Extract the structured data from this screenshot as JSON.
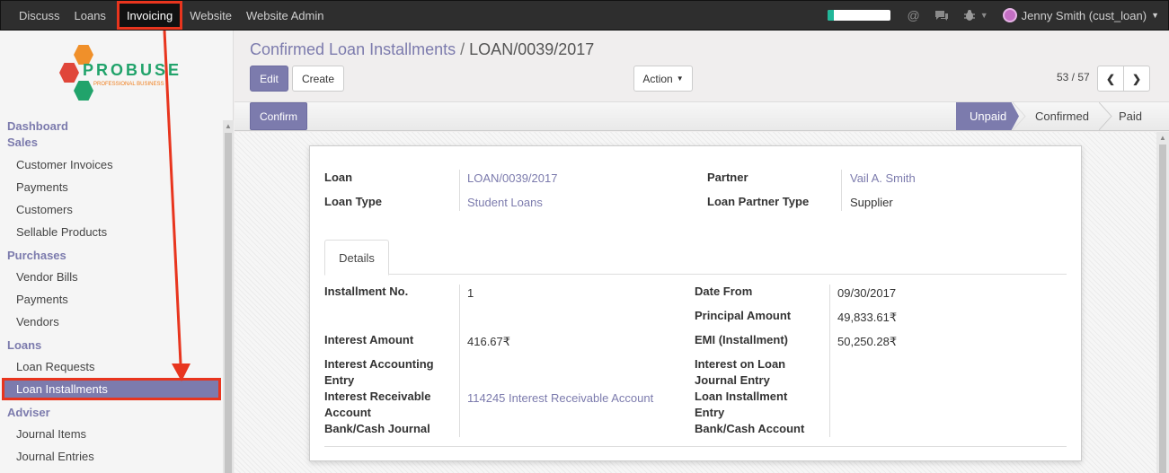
{
  "topbar": {
    "menu": [
      "Discuss",
      "Loans",
      "Invoicing",
      "Website",
      "Website Admin"
    ],
    "active": "Invoicing",
    "progress": 0.1,
    "user_name": "Jenny Smith (cust_loan)",
    "colors": {
      "bar": "#2e2e2e",
      "accent": "#7c7bad",
      "highlight": "#e8351e",
      "progress": "#21b799"
    }
  },
  "logo": {
    "word": "PROBUSE",
    "tagline": "PROFESSIONAL BUSINESS"
  },
  "sidebar": {
    "sections": [
      {
        "title": "Dashboard",
        "items": []
      },
      {
        "title": "Sales",
        "items": [
          "Customer Invoices",
          "Payments",
          "Customers",
          "Sellable Products"
        ]
      },
      {
        "title": "Purchases",
        "items": [
          "Vendor Bills",
          "Payments",
          "Vendors"
        ]
      },
      {
        "title": "Loans",
        "items": [
          "Loan Requests",
          "Loan Installments"
        ]
      },
      {
        "title": "Adviser",
        "items": [
          "Journal Items",
          "Journal Entries"
        ]
      }
    ],
    "active_item": "Loan Installments"
  },
  "breadcrumb": {
    "parent": "Confirmed Loan Installments",
    "sep": "/",
    "current": "LOAN/0039/2017"
  },
  "toolbar": {
    "edit": "Edit",
    "create": "Create",
    "action": "Action",
    "pager": "53 / 57"
  },
  "status": {
    "confirm": "Confirm",
    "stages": [
      "Unpaid",
      "Confirmed",
      "Paid"
    ],
    "active": "Unpaid"
  },
  "form": {
    "loan_label": "Loan",
    "loan_value": "LOAN/0039/2017",
    "loan_type_label": "Loan Type",
    "loan_type_value": "Student Loans",
    "partner_label": "Partner",
    "partner_value": "Vail A. Smith",
    "partner_type_label": "Loan Partner Type",
    "partner_type_value": "Supplier",
    "tab": "Details",
    "left": [
      {
        "label": "Installment No.",
        "value": "1"
      },
      {
        "label": "Interest Amount",
        "value": "416.67₹"
      },
      {
        "label": "Interest Accounting Entry",
        "value": ""
      },
      {
        "label": "Interest Receivable Account",
        "value": "114245 Interest Receivable Account"
      },
      {
        "label": "Bank/Cash Journal",
        "value": ""
      }
    ],
    "right": [
      {
        "label": "Date From",
        "value": "09/30/2017"
      },
      {
        "label": "Principal Amount",
        "value": "49,833.61₹"
      },
      {
        "label": "EMI (Installment)",
        "value": "50,250.28₹"
      },
      {
        "label": "Interest on Loan Journal Entry",
        "value": ""
      },
      {
        "label": "Loan Installment Entry",
        "value": ""
      },
      {
        "label": "Bank/Cash Account",
        "value": ""
      }
    ]
  }
}
